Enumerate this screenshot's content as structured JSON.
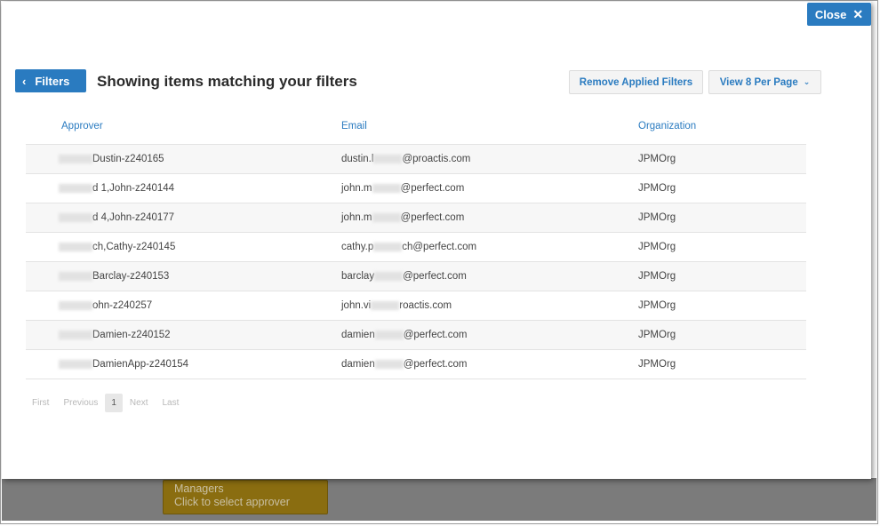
{
  "background": {
    "card_line1": "Managers",
    "card_line2": "Click to select approver"
  },
  "modal": {
    "close_label": "Close",
    "filters_label": "Filters",
    "title": "Showing items matching your filters",
    "remove_filters_label": "Remove Applied Filters",
    "per_page_label": "View 8 Per Page"
  },
  "table": {
    "headers": [
      "Approver",
      "Email",
      "Organization"
    ],
    "rows": [
      {
        "approver": "Dustin-z240165",
        "email_prefix": "dustin.l",
        "email_suffix": "@proactis.com",
        "org": "JPMOrg"
      },
      {
        "approver": "d 1,John-z240144",
        "email_prefix": "john.m",
        "email_suffix": "@perfect.com",
        "org": "JPMOrg"
      },
      {
        "approver": "d 4,John-z240177",
        "email_prefix": "john.m",
        "email_suffix": "@perfect.com",
        "org": "JPMOrg"
      },
      {
        "approver": "ch,Cathy-z240145",
        "email_prefix": "cathy.p",
        "email_suffix": "ch@perfect.com",
        "org": "JPMOrg"
      },
      {
        "approver": "Barclay-z240153",
        "email_prefix": "barclay",
        "email_suffix": "@perfect.com",
        "org": "JPMOrg"
      },
      {
        "approver": "ohn-z240257",
        "email_prefix": "john.vi",
        "email_suffix": "roactis.com",
        "org": "JPMOrg"
      },
      {
        "approver": "Damien-z240152",
        "email_prefix": "damien",
        "email_suffix": "@perfect.com",
        "org": "JPMOrg"
      },
      {
        "approver": "DamienApp-z240154",
        "email_prefix": "damien",
        "email_suffix": "@perfect.com",
        "org": "JPMOrg"
      }
    ]
  },
  "pager": {
    "first": "First",
    "previous": "Previous",
    "current": "1",
    "next": "Next",
    "last": "Last"
  }
}
